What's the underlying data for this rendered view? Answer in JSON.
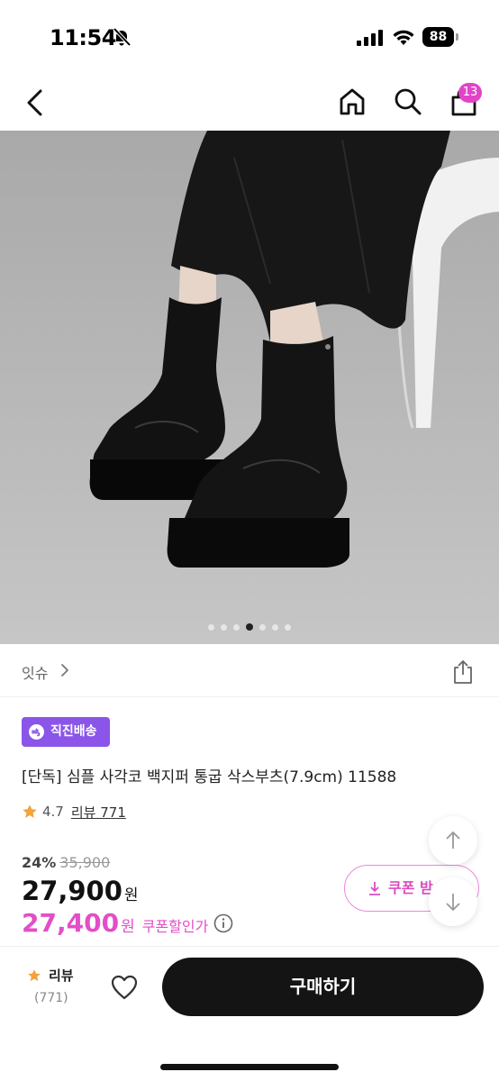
{
  "status_bar": {
    "time": "11:54",
    "battery": "88"
  },
  "nav": {
    "cart_count": "13"
  },
  "gallery": {
    "image_count": 7,
    "active_index": 3
  },
  "brand": {
    "name": "잇슈"
  },
  "product": {
    "badge": "직진배송",
    "title": "[단독] 심플 사각코 백지퍼 통굽 삭스부츠(7.9cm) 11588",
    "rating": "4.7",
    "review_link": "리뷰 771",
    "discount": "24%",
    "original_price": "35,900",
    "price": "27,900",
    "price_unit": "원",
    "coupon_price": "27,400",
    "coupon_unit": "원",
    "coupon_price_label": "쿠폰할인가",
    "coupon_button": "쿠폰 받"
  },
  "bottom_bar": {
    "review_label": "리뷰",
    "review_count": "(771)",
    "buy_button": "구매하기"
  },
  "colors": {
    "accent_pink": "#e24ec8",
    "badge_purple": "#8a55e8",
    "star": "#f2a33a",
    "buy_button_bg": "#141414"
  },
  "icons": [
    "bell-off-icon",
    "signal-icon",
    "wifi-icon",
    "back-icon",
    "home-icon",
    "search-icon",
    "cart-icon",
    "share-icon",
    "star-icon",
    "info-icon",
    "download-icon",
    "arrow-up-icon",
    "arrow-down-icon",
    "heart-icon"
  ]
}
